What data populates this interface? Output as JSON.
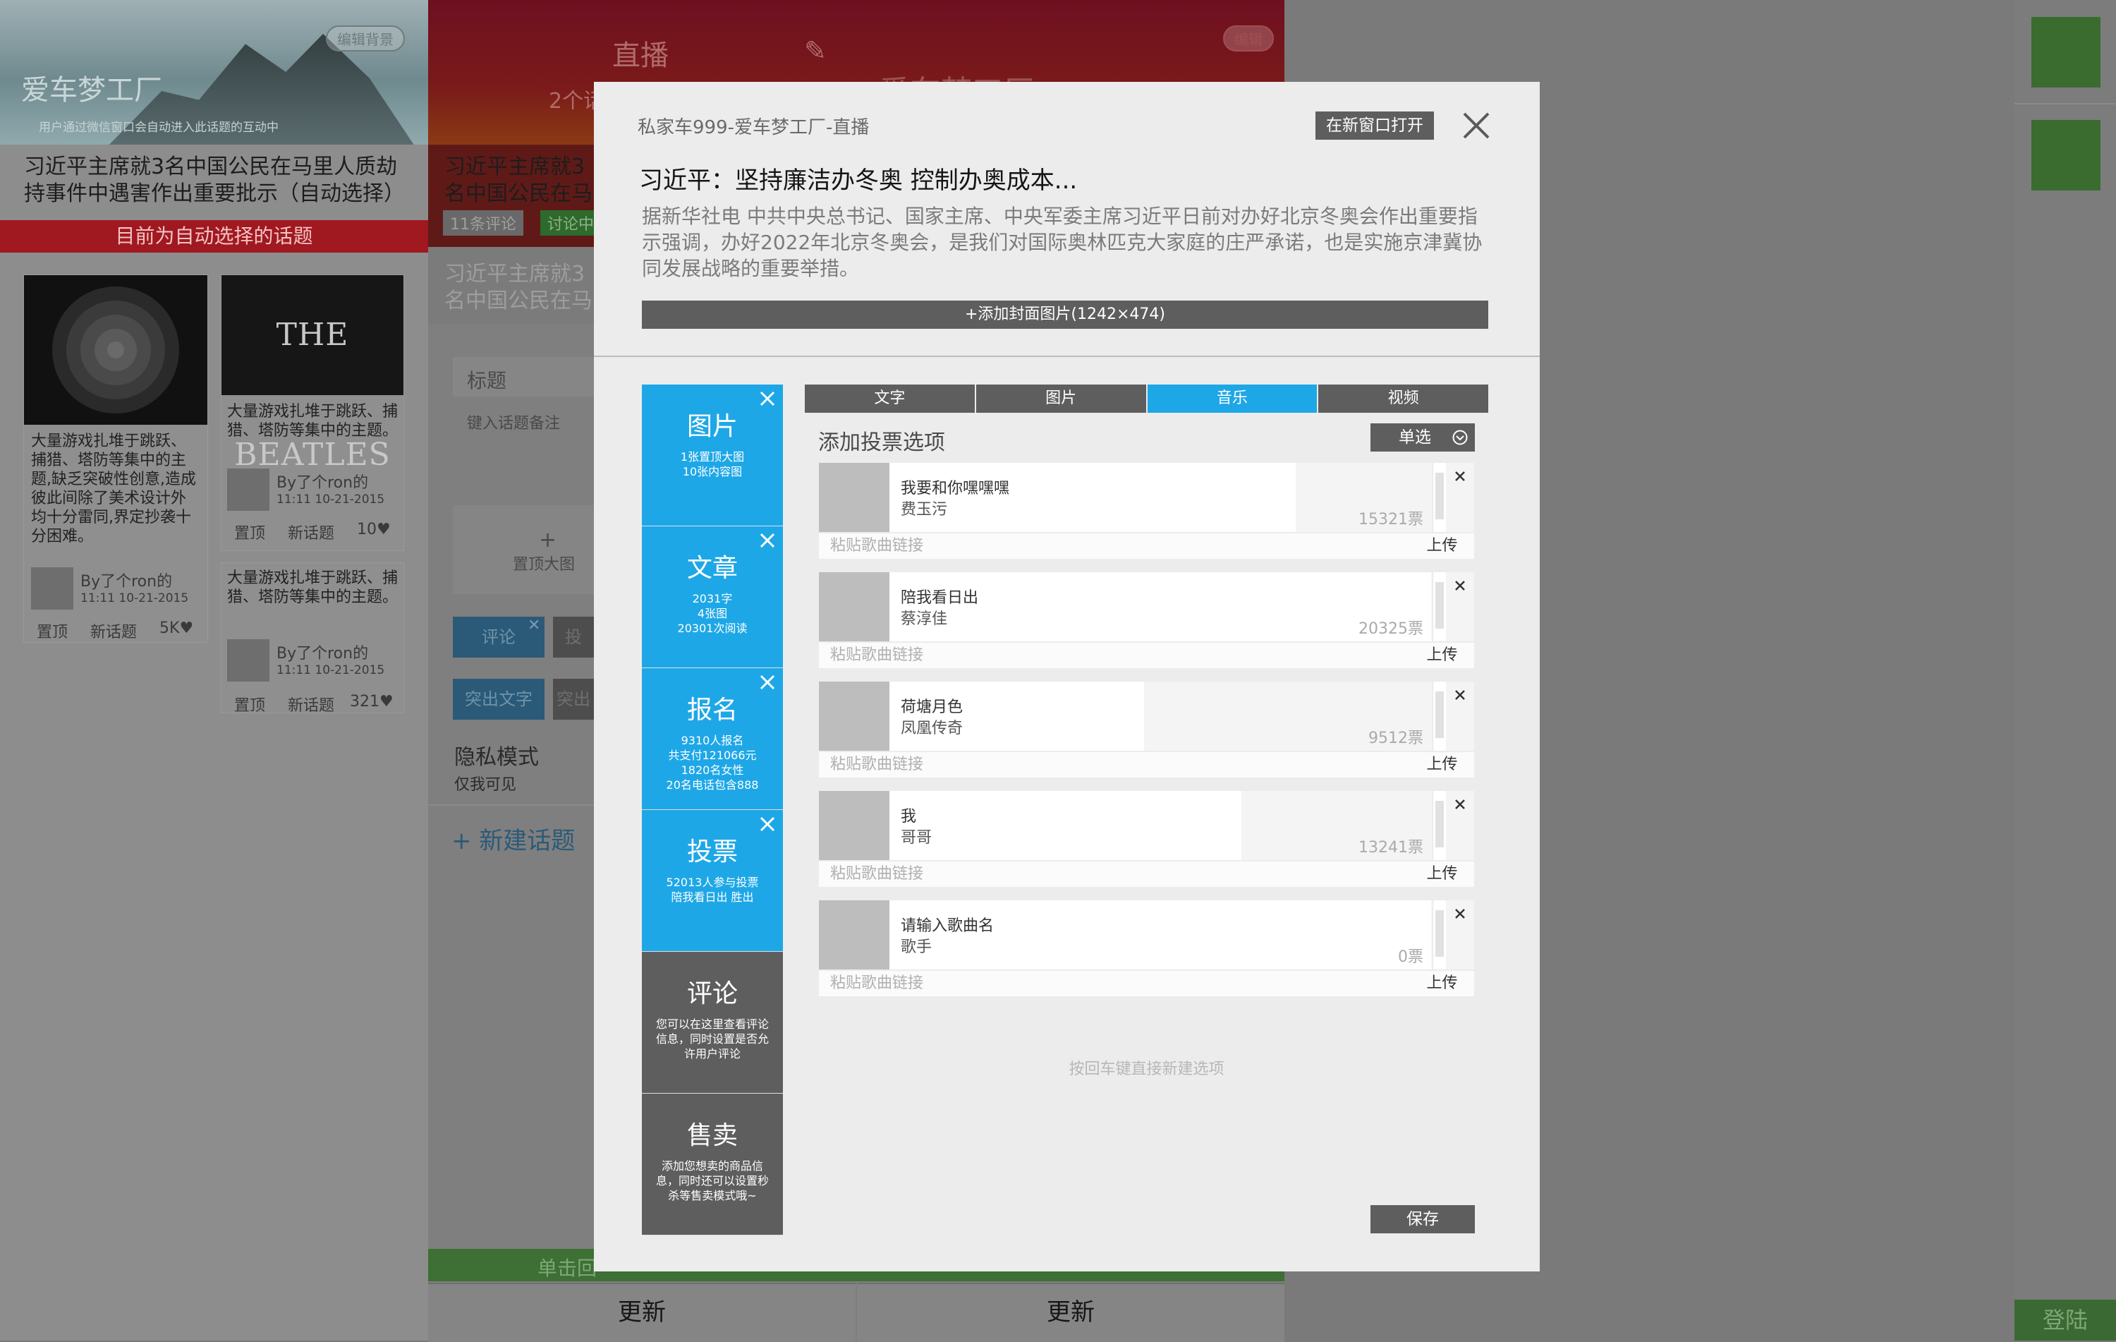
{
  "background": {
    "col1": {
      "hero_title": "爱车梦工厂",
      "hero_subtitle": "用户通过微信窗口会自动进入此话题的互动中",
      "hero_edit": "编辑背景",
      "topic_title": "习近平主席就3名中国公民在马里人质劫持事件中遇害作出重要批示（自动选择）",
      "auto_banner": "目前为自动选择的话题",
      "cards": [
        {
          "text": "大量游戏扎堆于跳跃、捕猎、塔防等集中的主题,缺乏突破性创意,造成彼此间除了美术设计外均十分雷同,界定抄袭十分困难。",
          "author": "By了个ron的",
          "time": "11:11 10-21-2015",
          "pin": "置顶",
          "new": "新话题",
          "likes": "5K"
        },
        {
          "text": "大量游戏扎堆于跳跃、捕猎、塔防等集中的主题。",
          "author": "By了个ron的",
          "time": "11:11 10-21-2015",
          "pin": "置顶",
          "new": "新话题",
          "likes": "10"
        },
        {
          "text": "大量游戏扎堆于跳跃、捕猎、塔防等集中的主题。",
          "author": "By了个ron的",
          "time": "11:11 10-21-2015",
          "pin": "置顶",
          "new": "新话题",
          "likes": "321"
        }
      ],
      "beatles": "THE BEATLES"
    },
    "col2": {
      "header": "直播",
      "sub": "2个话",
      "topic_title": "习近平主席就3名中国公民在马里人质劫持事件中遇害作",
      "comments_badge": "11条评论",
      "discuss_badge": "讨论中",
      "faded_title": "习近平主席就3名中国公民在马里人质劫持事件中遇害作",
      "label_title": "标题",
      "label_remark": "键入话题备注",
      "pin_image": "置顶大图",
      "comment_btn": "评论",
      "vote_btn": "投",
      "highlight_btn": "突出文字",
      "highlight_btn2": "突出",
      "privacy_title": "隐私模式",
      "privacy_sub": "仅我可见",
      "new_topic": "+ 新建话题",
      "bottom_hint": "单击回",
      "update": "更新"
    },
    "col3": {
      "header": "爱车梦工厂",
      "edit": "编辑",
      "update": "更新"
    },
    "rightbar": {
      "login": "登陆"
    }
  },
  "modal": {
    "breadcrumb": "私家车999-爱车梦工厂-直播",
    "open_new_window": "在新窗口打开",
    "title": "习近平：坚持廉洁办冬奥 控制办奥成本...",
    "description": "据新华社电 中共中央总书记、国家主席、中央军委主席习近平日前对办好北京冬奥会作出重要指示强调，办好2022年北京冬奥会，是我们对国际奥林匹克大家庭的庄严承诺，也是实施京津冀协同发展战略的重要举措。",
    "add_cover": "+添加封面图片(1242×474)",
    "side_items": [
      {
        "title": "图片",
        "desc": "1张置顶大图\n10张内容图",
        "active": true
      },
      {
        "title": "文章",
        "desc": "2031字\n4张图\n20301次阅读",
        "active": true
      },
      {
        "title": "报名",
        "desc": "9310人报名\n共支付121066元\n1820名女性\n20名电话包含888",
        "active": true
      },
      {
        "title": "投票",
        "desc": "52013人参与投票\n陪我看日出 胜出",
        "active": true
      },
      {
        "title": "评论",
        "desc": "您可以在这里查看评论信息，同时设置是否允许用户评论",
        "active": false
      },
      {
        "title": "售卖",
        "desc": "添加您想卖的商品信息，同时还可以设置秒杀等售卖模式哦~",
        "active": false
      }
    ],
    "tabs": [
      "文字",
      "图片",
      "音乐",
      "视频"
    ],
    "active_tab": "音乐",
    "vote_header": "添加投票选项",
    "vote_mode": "单选",
    "options": [
      {
        "name": "我要和你嘿嘿嘿",
        "artist": "费玉污",
        "votes": "15321票",
        "link_placeholder": "粘贴歌曲链接",
        "upload": "上传",
        "ratio": 0.75
      },
      {
        "name": "陪我看日出",
        "artist": "蔡淳佳",
        "votes": "20325票",
        "link_placeholder": "粘贴歌曲链接",
        "upload": "上传",
        "ratio": 1.0
      },
      {
        "name": "荷塘月色",
        "artist": "凤凰传奇",
        "votes": "9512票",
        "link_placeholder": "粘贴歌曲链接",
        "upload": "上传",
        "ratio": 0.47
      },
      {
        "name": "我",
        "artist": "哥哥",
        "votes": "13241票",
        "link_placeholder": "粘贴歌曲链接",
        "upload": "上传",
        "ratio": 0.65
      },
      {
        "name": "请输入歌曲名",
        "artist": "歌手",
        "votes": "0票",
        "link_placeholder": "粘贴歌曲链接",
        "upload": "上传",
        "ratio": 1.0
      }
    ],
    "enter_hint": "按回车键直接新建选项",
    "save": "保存"
  }
}
